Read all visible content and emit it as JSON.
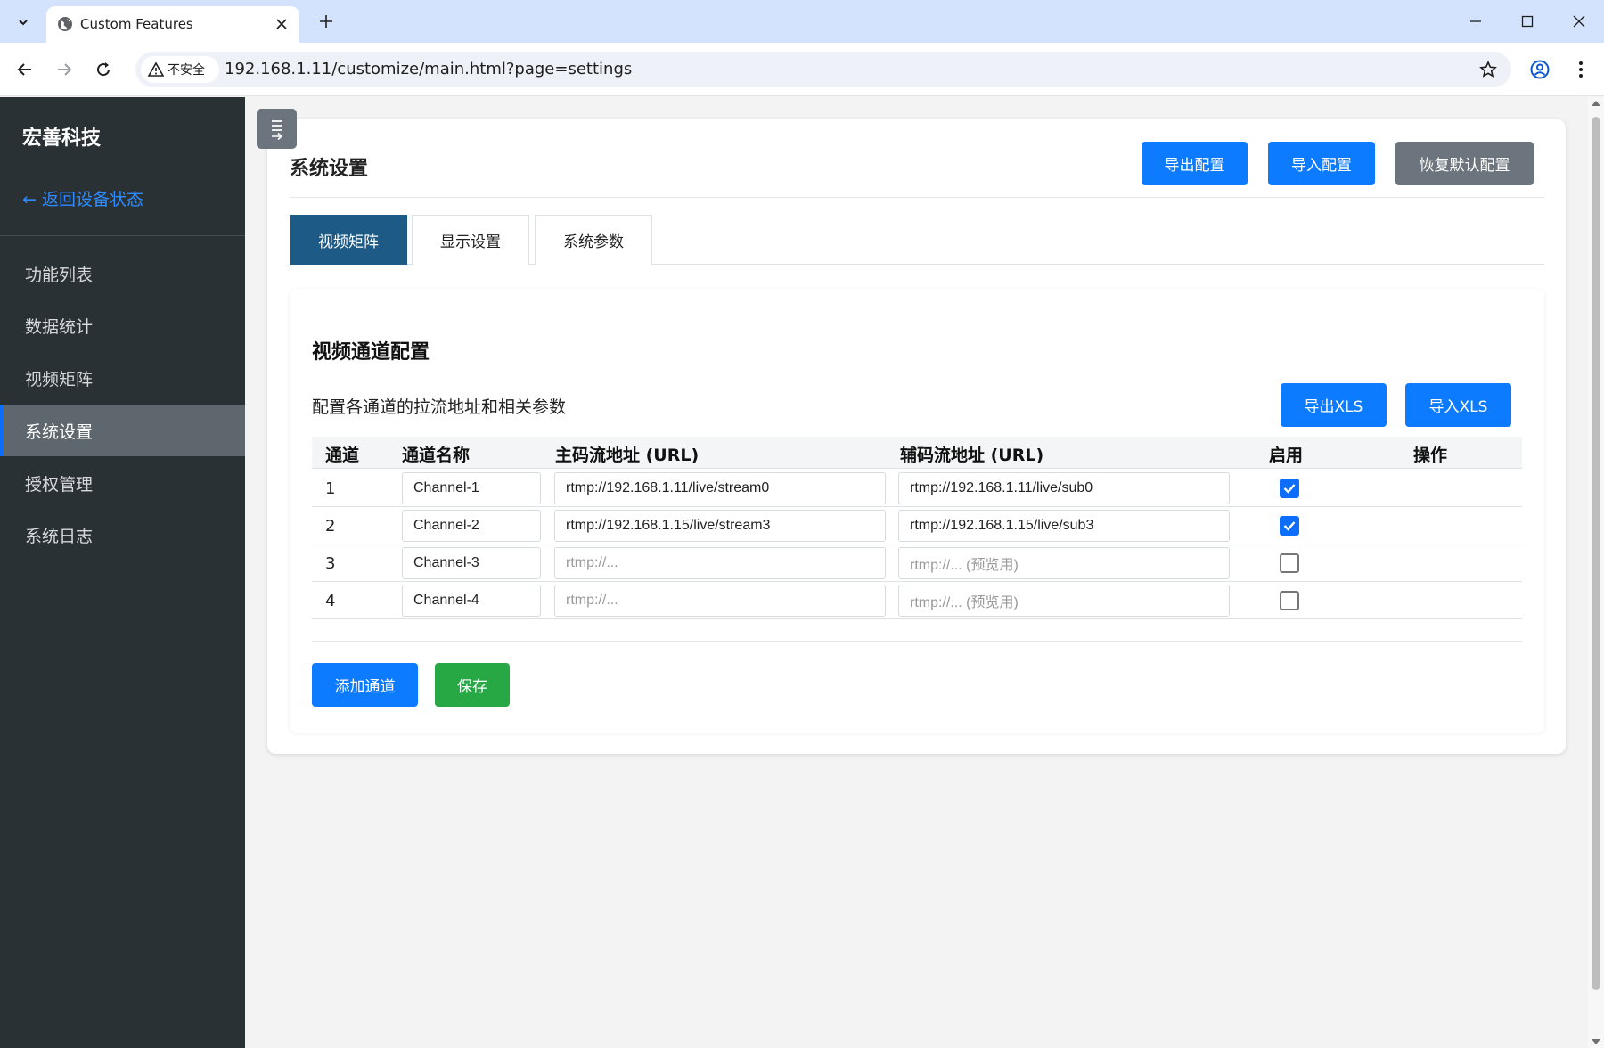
{
  "browser": {
    "tab_title": "Custom Features",
    "security_label": "不安全",
    "url": "192.168.1.11/customize/main.html?page=settings"
  },
  "sidebar": {
    "brand": "宏善科技",
    "back_link": "← 返回设备状态",
    "items": [
      {
        "label": "功能列表"
      },
      {
        "label": "数据统计"
      },
      {
        "label": "视频矩阵"
      },
      {
        "label": "系统设置",
        "active": true
      },
      {
        "label": "授权管理"
      },
      {
        "label": "系统日志"
      }
    ]
  },
  "header": {
    "title": "系统设置",
    "export_config": "导出配置",
    "import_config": "导入配置",
    "restore_default": "恢复默认配置"
  },
  "tabs": [
    {
      "label": "视频矩阵",
      "active": true
    },
    {
      "label": "显示设置"
    },
    {
      "label": "系统参数"
    }
  ],
  "panel": {
    "title": "视频通道配置",
    "description": "配置各通道的拉流地址和相关参数",
    "export_xls": "导出XLS",
    "import_xls": "导入XLS",
    "columns": [
      "通道",
      "通道名称",
      "主码流地址 (URL)",
      "辅码流地址 (URL)",
      "启用",
      "操作"
    ],
    "rows": [
      {
        "channel": "1",
        "name": "Channel-1",
        "main_url": "rtmp://192.168.1.11/live/stream0",
        "sub_url": "rtmp://192.168.1.11/live/sub0",
        "enabled": true
      },
      {
        "channel": "2",
        "name": "Channel-2",
        "main_url": "rtmp://192.168.1.15/live/stream3",
        "sub_url": "rtmp://192.168.1.15/live/sub3",
        "enabled": true
      },
      {
        "channel": "3",
        "name": "Channel-3",
        "main_url": "",
        "sub_url": "",
        "enabled": false
      },
      {
        "channel": "4",
        "name": "Channel-4",
        "main_url": "",
        "sub_url": "",
        "enabled": false
      }
    ],
    "main_url_placeholder": "rtmp://...",
    "sub_url_placeholder": "rtmp://... (预览用)",
    "add_channel": "添加通道",
    "save": "保存"
  },
  "colors": {
    "primary": "#0d7bff",
    "secondary": "#6c757d",
    "success": "#28a745",
    "sidebar_bg": "#2a3135",
    "active_tab": "#1d5a85"
  }
}
